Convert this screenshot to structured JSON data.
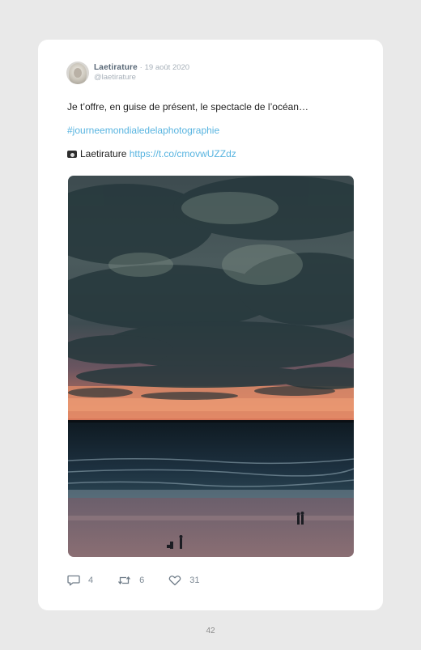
{
  "tweet": {
    "display_name": "Laetirature",
    "separator": "·",
    "date": "19 août 2020",
    "handle": "@laetirature",
    "text_line1": "Je t’offre, en guise de présent, le spectacle de l’océan…",
    "hashtag": "#journeemondialedelaphotographie",
    "credit_name": "Laetirature",
    "credit_link": "https://t.co/cmovwUZZdz"
  },
  "photo": {
    "subject": "cloudy sunset over the ocean with people on the beach"
  },
  "actions": {
    "replies": "4",
    "retweets": "6",
    "likes": "31"
  },
  "icons": {
    "reply": "reply-bubble-icon",
    "retweet": "retweet-icon",
    "like": "heart-icon",
    "camera": "camera-icon"
  },
  "colors": {
    "link": "#58b4e0",
    "name": "#566574",
    "meta": "#a7b0b9"
  },
  "page_number": "42"
}
